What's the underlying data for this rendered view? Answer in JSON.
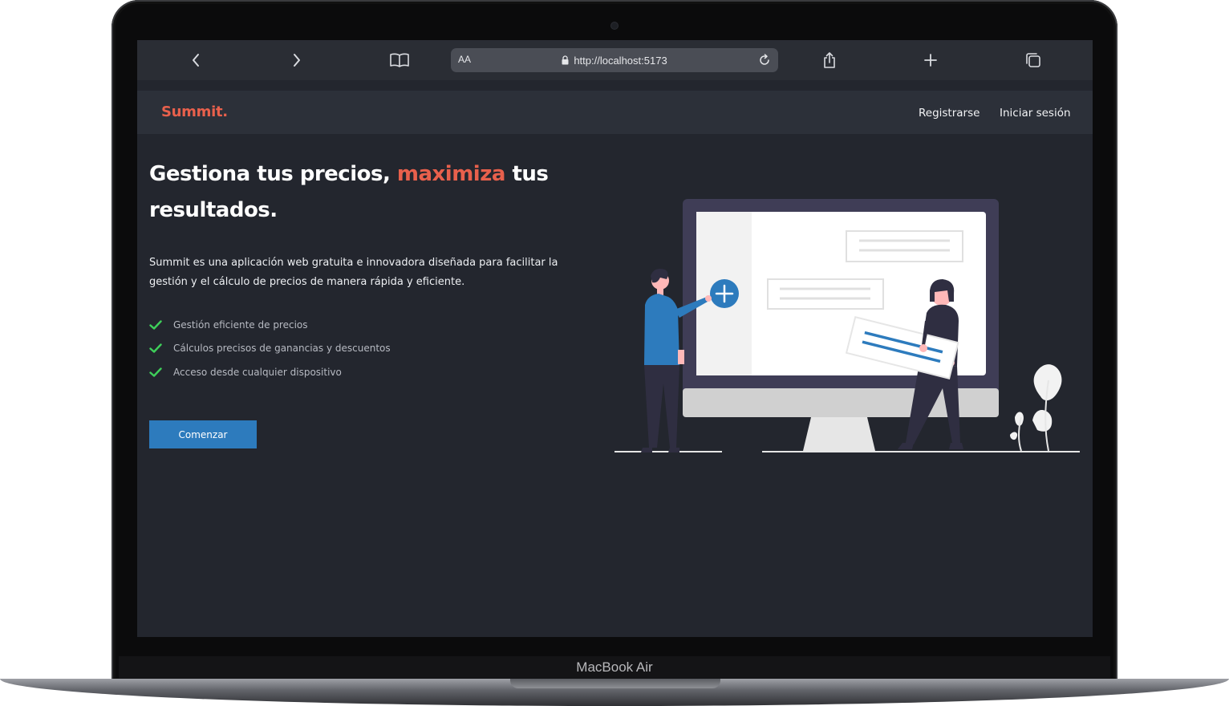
{
  "device": {
    "label": "MacBook Air"
  },
  "browser": {
    "text_size_label": "AA",
    "url": "http://localhost:5173"
  },
  "app": {
    "logo": "Summit.",
    "nav": {
      "register": "Registrarse",
      "login": "Iniciar sesión"
    },
    "hero": {
      "title_part1": "Gestiona tus precios, ",
      "title_accent": "maximiza",
      "title_part2": " tus resultados.",
      "description": "Summit es una aplicación web gratuita e innovadora diseñada para facilitar la gestión y el cálculo de precios de manera rápida y eficiente.",
      "features": [
        "Gestión eficiente de precios",
        "Cálculos precisos de ganancias y descuentos",
        "Acceso desde cualquier dispositivo"
      ],
      "cta": "Comenzar"
    }
  },
  "colors": {
    "background": "#23262e",
    "navbar": "#2c3039",
    "accent": "#e8604c",
    "primary": "#2d7bbd",
    "check": "#3ecf5a"
  }
}
